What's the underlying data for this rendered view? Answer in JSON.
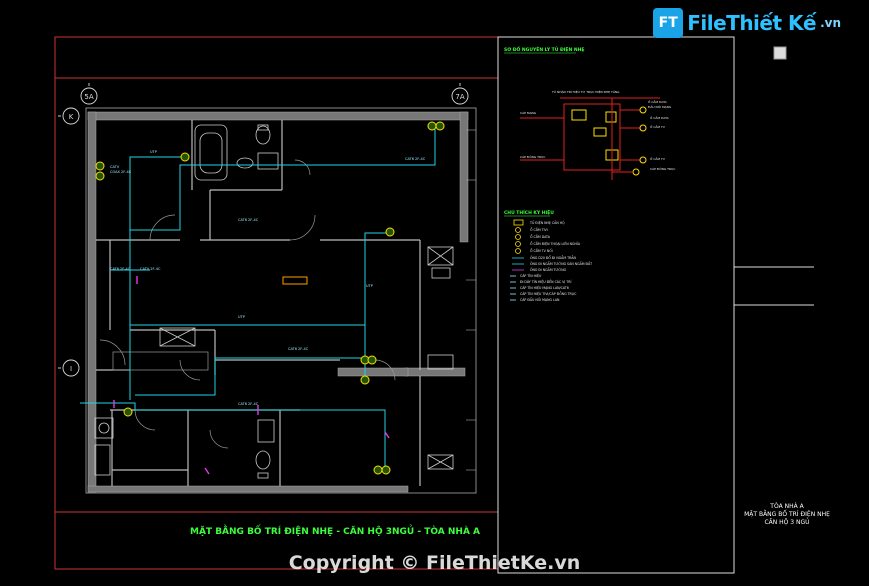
{
  "logo": {
    "icon_text": "FT",
    "name": "FileThiết Kế",
    "suffix": ".vn"
  },
  "plan_title": "MẶT BẰNG BỐ TRÍ ĐIỆN NHẸ - CĂN HỘ 3NGỦ - TÒA NHÀ A",
  "watermark": "Copyright © FileThietKe.vn",
  "grid_labels": {
    "top_left": "5A",
    "top_right": "7A",
    "left_top": "K",
    "left_mid": "I"
  },
  "schematic_title": "SƠ ĐỒ NGUYÊN LÝ TỦ ĐIỆN NHẸ",
  "legend_title": "CHÚ THÍCH KÝ HIỆU",
  "legend_items": [
    "TỦ ĐIỆN NHẸ CĂN HỘ",
    "Ổ CẮM TIVI",
    "Ổ CẮM DATA",
    "Ổ CẮM ĐIỆN THOẠI LIÊN NGHĨA",
    "Ổ CẮM TV NỐI",
    "ỐNG D20 ĐỔ ĐI NGẦM TRẦN",
    "ỐNG ĐI NGẦM TƯỜNG SÀN NGẦM ĐẤT",
    "ỐNG ĐI NGẦM TƯỜNG",
    "CÁP TÍN HIỆU",
    "ĐI DÂY TÍN HIỆU ĐẾN CÁC VỊ TRÍ",
    "CÁP TÍN HIỆU MẠNG LAN/CAT6",
    "CÁP TÍN HIỆU TIVI/CÁP ĐỒNG TRỤC",
    "CÁP ĐẦU NỐI MẠNG LAN"
  ],
  "title_block": {
    "line1": "TÒA NHÀ A",
    "line2": "MẶT BẰNG BỐ TRÍ ĐIỆN NHẸ",
    "line3": "CĂN HỘ 3 NGỦ"
  }
}
